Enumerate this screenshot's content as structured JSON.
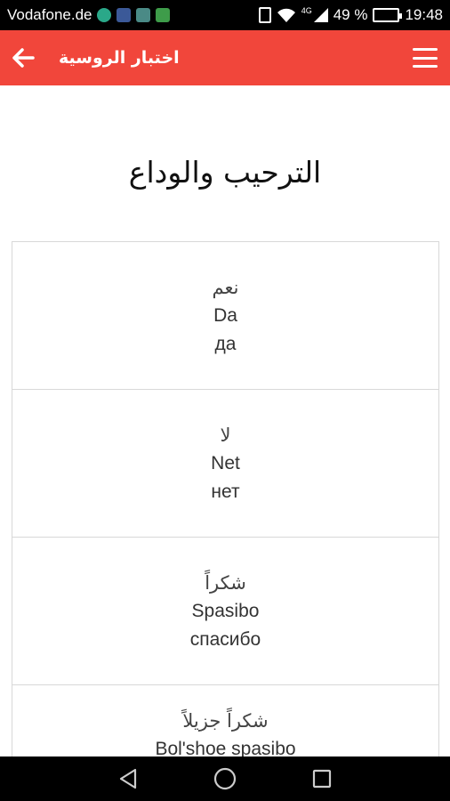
{
  "status_bar": {
    "carrier": "Vodafone.de",
    "network_label": "4G",
    "battery_percent": "49 %",
    "battery_level": 0.49,
    "time": "19:48",
    "notification_icons": [
      "globe-icon",
      "gallery-icon",
      "photo-icon",
      "android-icon"
    ]
  },
  "app_bar": {
    "title": "اختبار الروسية",
    "back_icon": "arrow-left-icon",
    "menu_icon": "hamburger-menu-icon",
    "color": "#f1463b"
  },
  "main": {
    "heading": "الترحيب والوداع",
    "cards": [
      {
        "arabic": "نعم",
        "latin": "Da",
        "cyrillic": "да"
      },
      {
        "arabic": "لا",
        "latin": "Net",
        "cyrillic": "нет"
      },
      {
        "arabic": "شكراً",
        "latin": "Spasibo",
        "cyrillic": "спасибо"
      },
      {
        "arabic": "شكراً جزيلاً",
        "latin": "Bol'shoe spasibo",
        "cyrillic": ""
      }
    ]
  },
  "nav_bar": {
    "back_icon": "nav-back-triangle-icon",
    "home_icon": "nav-home-circle-icon",
    "recents_icon": "nav-recents-square-icon"
  }
}
